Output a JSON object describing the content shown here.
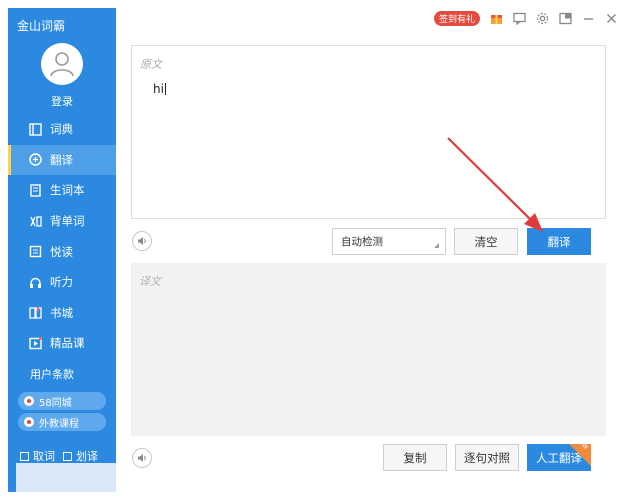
{
  "app": {
    "title": "金山词霸"
  },
  "sidebar": {
    "login": "登录",
    "items": [
      {
        "label": "词典",
        "icon": "book-icon"
      },
      {
        "label": "翻译",
        "icon": "translate-icon",
        "active": true
      },
      {
        "label": "生词本",
        "icon": "notebook-icon"
      },
      {
        "label": "背单词",
        "icon": "memorize-icon"
      },
      {
        "label": "悦读",
        "icon": "reading-icon"
      },
      {
        "label": "听力",
        "icon": "headphones-icon"
      },
      {
        "label": "书城",
        "icon": "bookstore-icon"
      },
      {
        "label": "精品课",
        "icon": "video-course-icon"
      }
    ],
    "terms": "用户条款",
    "promos": [
      {
        "label": "58同城"
      },
      {
        "label": "外教课程"
      }
    ],
    "checkboxes": [
      {
        "label": "取词"
      },
      {
        "label": "划译"
      }
    ]
  },
  "topbar": {
    "signin_badge": "签到有礼"
  },
  "translate": {
    "source_label": "原文",
    "source_text": "hi",
    "language_select": "自动检测",
    "clear_button": "清空",
    "translate_button": "翻译",
    "target_label": "译文",
    "copy_button": "复制",
    "compare_button": "逐句对照",
    "human_button": "人工翻译",
    "new_tag": "NEW"
  },
  "colors": {
    "sidebar": "#2b8ae0",
    "accent": "#2b8ae0",
    "arrow": "#e03b3b",
    "badge": "#e34b3f"
  }
}
